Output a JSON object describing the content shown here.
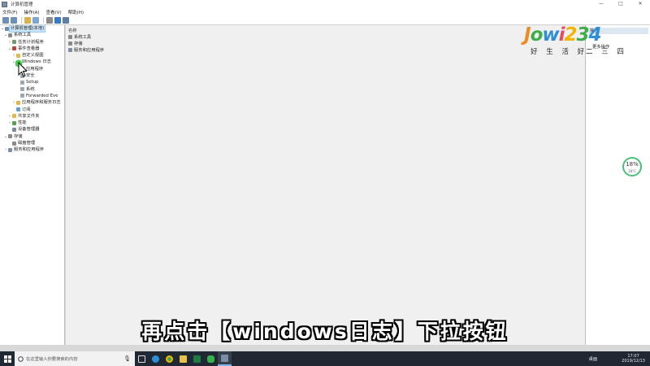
{
  "window": {
    "title": "计算机管理",
    "minimize_glyph": "—",
    "maximize_glyph": "□",
    "close_glyph": "✕"
  },
  "menu": [
    "文件(F)",
    "操作(A)",
    "查看(V)",
    "帮助(H)"
  ],
  "toolbar_icons": [
    "back-icon",
    "forward-icon",
    "up-icon",
    "show-hide-tree-icon",
    "properties-icon",
    "help-icon",
    "console-icon"
  ],
  "tree": [
    {
      "label": "计算机管理(本地)",
      "arrow": "⌄",
      "icon": "computer-icon",
      "level": 0,
      "selected": true
    },
    {
      "label": "系统工具",
      "arrow": "⌄",
      "icon": "tools-icon",
      "level": 1
    },
    {
      "label": "任务计划程序",
      "arrow": "›",
      "icon": "clock-icon",
      "level": 2
    },
    {
      "label": "事件查看器",
      "arrow": "⌄",
      "icon": "event-viewer-icon",
      "level": 2
    },
    {
      "label": "自定义视图",
      "arrow": "›",
      "icon": "folder-icon",
      "level": 3
    },
    {
      "label": "Windows 日志",
      "arrow": "⌄",
      "icon": "folder-icon",
      "level": 3
    },
    {
      "label": "应用程序",
      "arrow": "",
      "icon": "log-icon",
      "level": 4
    },
    {
      "label": "安全",
      "arrow": "",
      "icon": "log-icon",
      "level": 4
    },
    {
      "label": "Setup",
      "arrow": "",
      "icon": "log-icon",
      "level": 4
    },
    {
      "label": "系统",
      "arrow": "",
      "icon": "log-icon",
      "level": 4
    },
    {
      "label": "Forwarded Eve",
      "arrow": "",
      "icon": "log-icon",
      "level": 4
    },
    {
      "label": "应用程序和服务日志",
      "arrow": "›",
      "icon": "folder-icon",
      "level": 3
    },
    {
      "label": "订阅",
      "arrow": "",
      "icon": "subscription-icon",
      "level": 3
    },
    {
      "label": "共享文件夹",
      "arrow": "›",
      "icon": "shared-folder-icon",
      "level": 2
    },
    {
      "label": "性能",
      "arrow": "›",
      "icon": "performance-icon",
      "level": 2
    },
    {
      "label": "设备管理器",
      "arrow": "",
      "icon": "device-manager-icon",
      "level": 2
    },
    {
      "label": "存储",
      "arrow": "⌄",
      "icon": "storage-icon",
      "level": 1
    },
    {
      "label": "磁盘管理",
      "arrow": "",
      "icon": "disk-icon",
      "level": 2
    },
    {
      "label": "服务和应用程序",
      "arrow": "›",
      "icon": "services-icon",
      "level": 1
    }
  ],
  "center": {
    "column_header": "名称",
    "rows": [
      {
        "label": "系统工具",
        "icon": "tools-icon"
      },
      {
        "label": "存储",
        "icon": "storage-icon"
      },
      {
        "label": "服务和应用程序",
        "icon": "services-icon"
      }
    ]
  },
  "actions": {
    "header": "操作",
    "item": "更多操作"
  },
  "logo": {
    "wordmark": "Jowi234",
    "slogan": "好 生 活 好",
    "slogan2": "二 三 四"
  },
  "subtitle": "再点击【windows日志】下拉按钮",
  "widget": {
    "percent": "18%",
    "temp": "38°C"
  },
  "taskbar": {
    "search_placeholder": "在这里输入你要搜索的内容",
    "mic_glyph": "🎙",
    "apps": [
      "task-view-icon",
      "edge-icon",
      "chrome-icon",
      "file-explorer-icon",
      "excel-icon",
      "wechat-icon",
      "computer-management-icon"
    ],
    "desktop_label": "桌面",
    "time": "17:07",
    "date": "2019/12/13"
  }
}
